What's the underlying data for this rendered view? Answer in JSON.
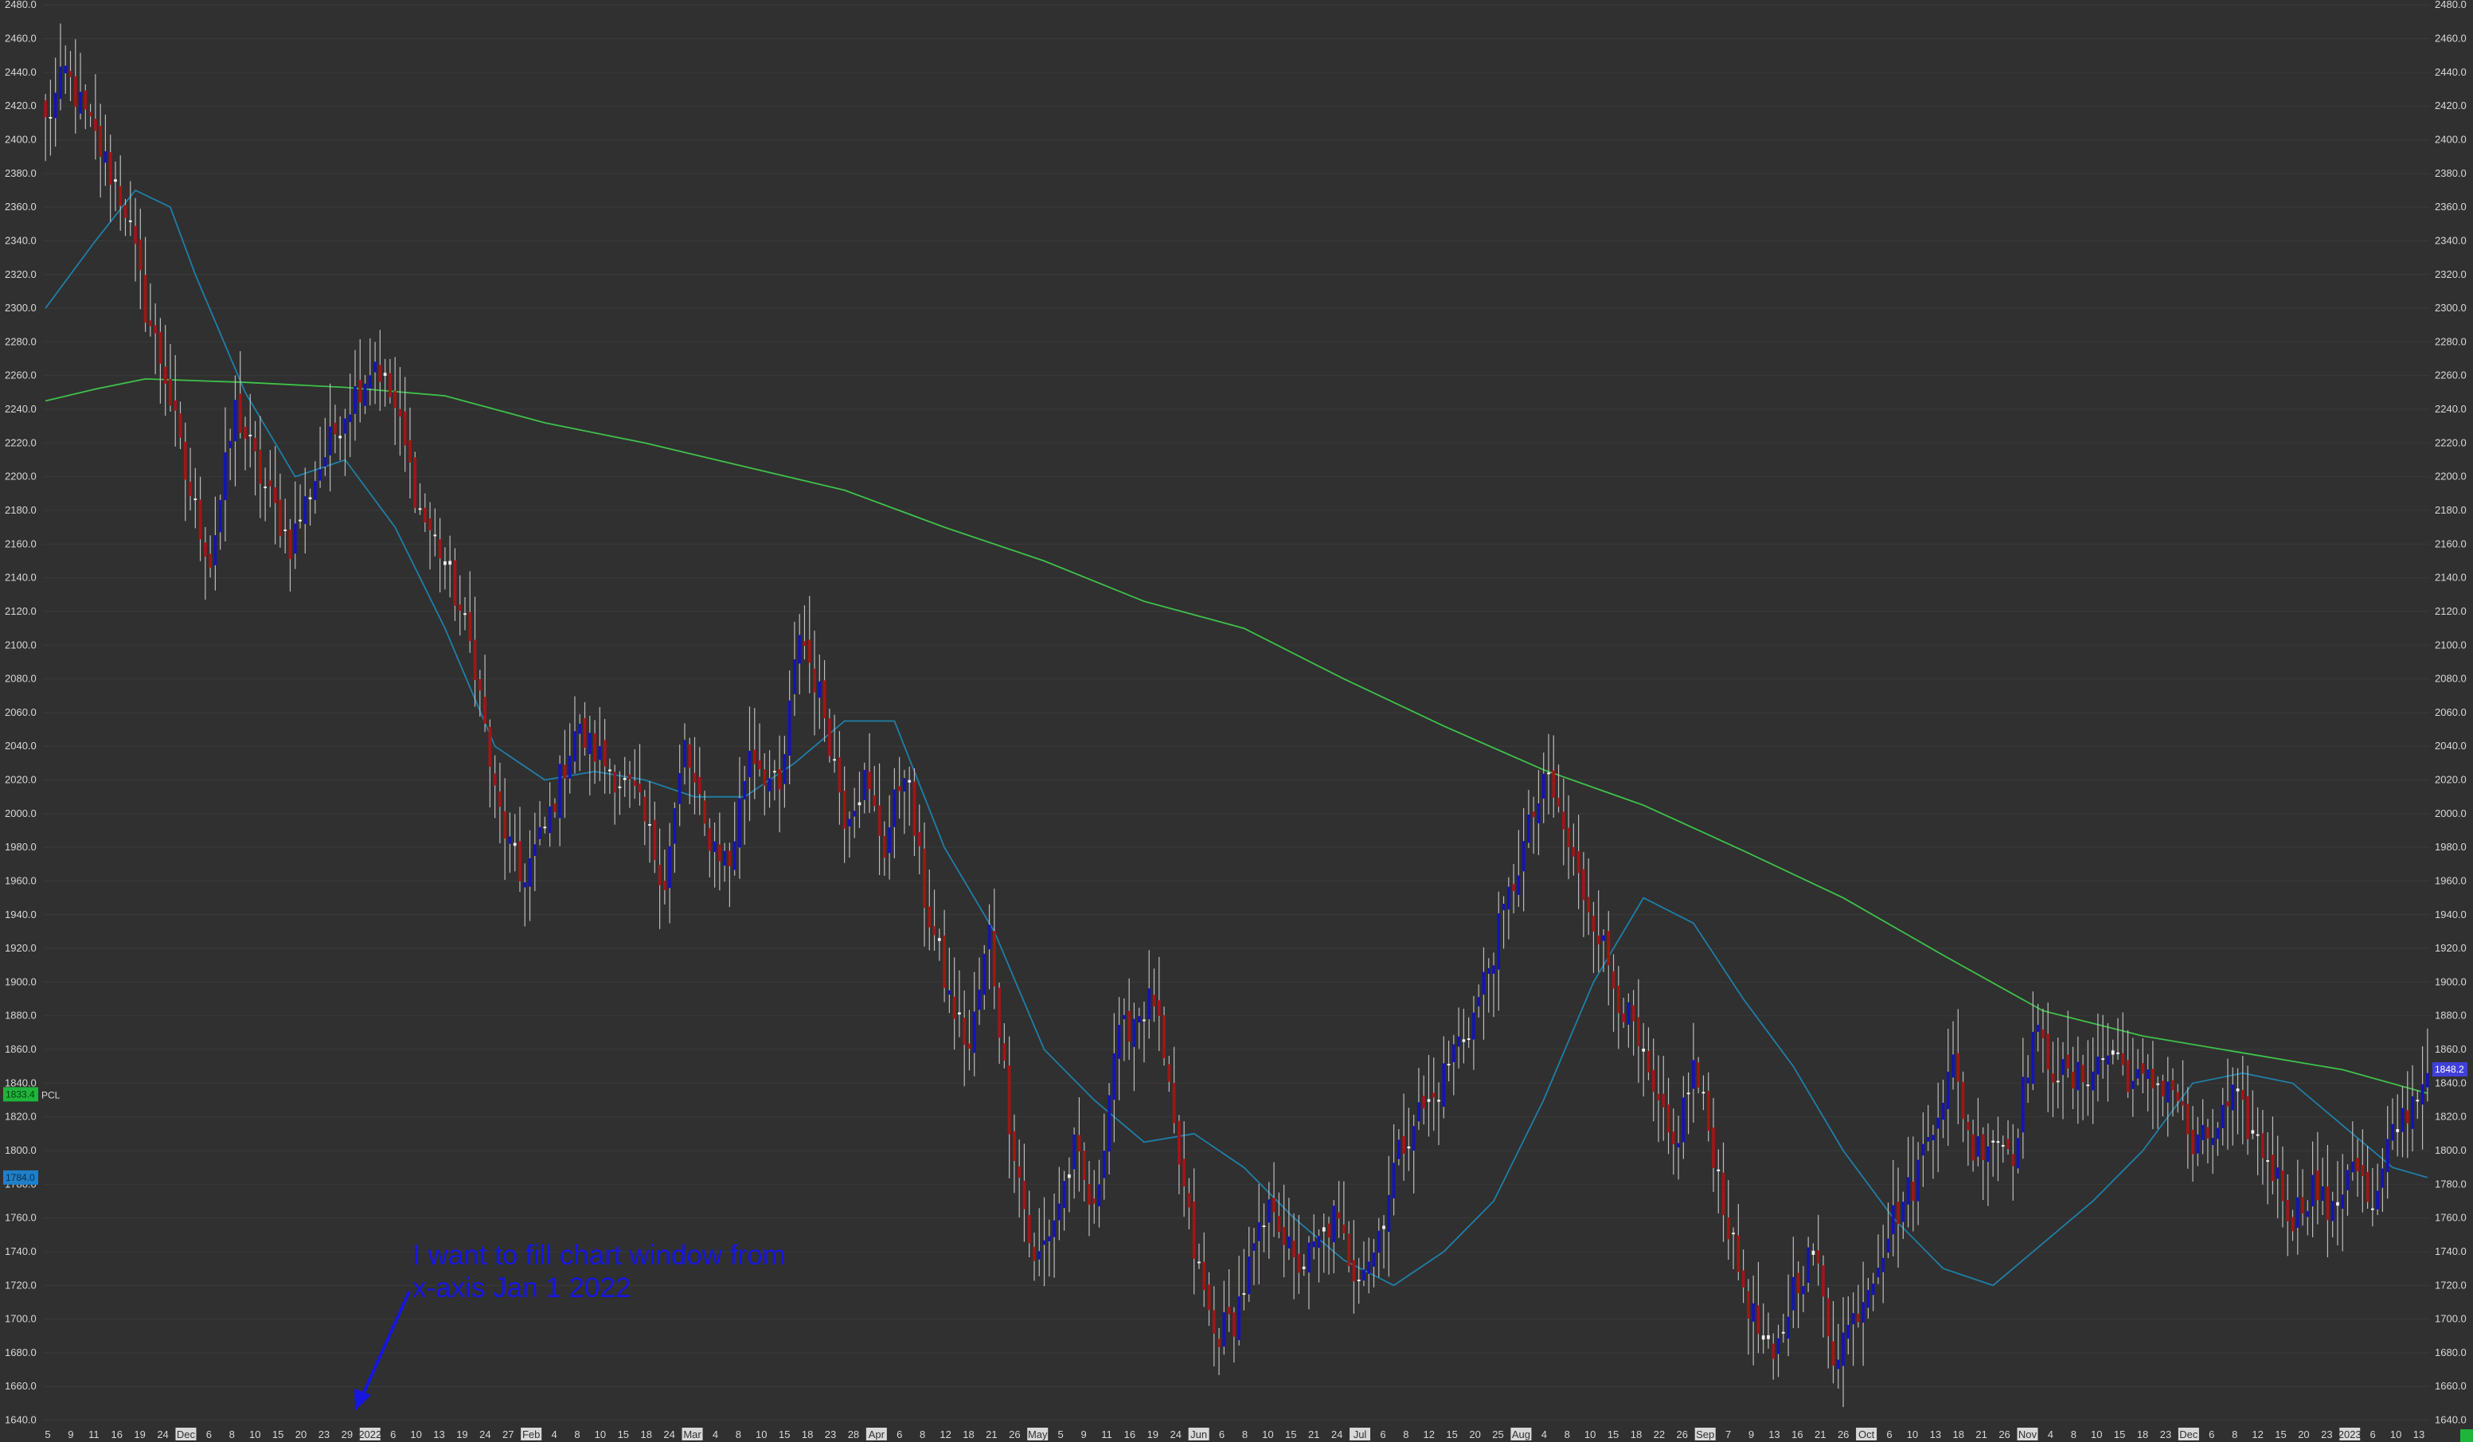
{
  "chart_data": {
    "type": "candlestick",
    "title": "",
    "xlabel": "",
    "ylabel": "",
    "ylim": [
      1636,
      2482
    ],
    "y_ticks": [
      1640,
      1660,
      1680,
      1700,
      1720,
      1740,
      1760,
      1780,
      1800,
      1820,
      1840,
      1860,
      1880,
      1900,
      1920,
      1940,
      1960,
      1980,
      2000,
      2020,
      2040,
      2060,
      2080,
      2100,
      2120,
      2140,
      2160,
      2180,
      2200,
      2220,
      2240,
      2260,
      2280,
      2300,
      2320,
      2340,
      2360,
      2380,
      2400,
      2420,
      2440,
      2460,
      2480
    ],
    "y_tick_decimals": 1,
    "x_tick_labels": [
      {
        "text": "5",
        "highlight": false
      },
      {
        "text": "9",
        "highlight": false
      },
      {
        "text": "11",
        "highlight": false
      },
      {
        "text": "16",
        "highlight": false
      },
      {
        "text": "19",
        "highlight": false
      },
      {
        "text": "24",
        "highlight": false
      },
      {
        "text": "Dec",
        "highlight": true
      },
      {
        "text": "6",
        "highlight": false
      },
      {
        "text": "8",
        "highlight": false
      },
      {
        "text": "10",
        "highlight": false
      },
      {
        "text": "15",
        "highlight": false
      },
      {
        "text": "20",
        "highlight": false
      },
      {
        "text": "23",
        "highlight": false
      },
      {
        "text": "29",
        "highlight": false
      },
      {
        "text": "2022",
        "highlight": true
      },
      {
        "text": "6",
        "highlight": false
      },
      {
        "text": "10",
        "highlight": false
      },
      {
        "text": "13",
        "highlight": false
      },
      {
        "text": "19",
        "highlight": false
      },
      {
        "text": "24",
        "highlight": false
      },
      {
        "text": "27",
        "highlight": false
      },
      {
        "text": "Feb",
        "highlight": true
      },
      {
        "text": "4",
        "highlight": false
      },
      {
        "text": "8",
        "highlight": false
      },
      {
        "text": "10",
        "highlight": false
      },
      {
        "text": "15",
        "highlight": false
      },
      {
        "text": "18",
        "highlight": false
      },
      {
        "text": "24",
        "highlight": false
      },
      {
        "text": "Mar",
        "highlight": true
      },
      {
        "text": "4",
        "highlight": false
      },
      {
        "text": "8",
        "highlight": false
      },
      {
        "text": "10",
        "highlight": false
      },
      {
        "text": "15",
        "highlight": false
      },
      {
        "text": "18",
        "highlight": false
      },
      {
        "text": "23",
        "highlight": false
      },
      {
        "text": "28",
        "highlight": false
      },
      {
        "text": "Apr",
        "highlight": true
      },
      {
        "text": "6",
        "highlight": false
      },
      {
        "text": "8",
        "highlight": false
      },
      {
        "text": "12",
        "highlight": false
      },
      {
        "text": "18",
        "highlight": false
      },
      {
        "text": "21",
        "highlight": false
      },
      {
        "text": "26",
        "highlight": false
      },
      {
        "text": "May",
        "highlight": true
      },
      {
        "text": "5",
        "highlight": false
      },
      {
        "text": "9",
        "highlight": false
      },
      {
        "text": "11",
        "highlight": false
      },
      {
        "text": "16",
        "highlight": false
      },
      {
        "text": "19",
        "highlight": false
      },
      {
        "text": "24",
        "highlight": false
      },
      {
        "text": "Jun",
        "highlight": true
      },
      {
        "text": "6",
        "highlight": false
      },
      {
        "text": "8",
        "highlight": false
      },
      {
        "text": "10",
        "highlight": false
      },
      {
        "text": "15",
        "highlight": false
      },
      {
        "text": "21",
        "highlight": false
      },
      {
        "text": "24",
        "highlight": false
      },
      {
        "text": "Jul",
        "highlight": true
      },
      {
        "text": "6",
        "highlight": false
      },
      {
        "text": "8",
        "highlight": false
      },
      {
        "text": "12",
        "highlight": false
      },
      {
        "text": "15",
        "highlight": false
      },
      {
        "text": "20",
        "highlight": false
      },
      {
        "text": "25",
        "highlight": false
      },
      {
        "text": "Aug",
        "highlight": true
      },
      {
        "text": "4",
        "highlight": false
      },
      {
        "text": "8",
        "highlight": false
      },
      {
        "text": "10",
        "highlight": false
      },
      {
        "text": "15",
        "highlight": false
      },
      {
        "text": "18",
        "highlight": false
      },
      {
        "text": "22",
        "highlight": false
      },
      {
        "text": "26",
        "highlight": false
      },
      {
        "text": "Sep",
        "highlight": true
      },
      {
        "text": "7",
        "highlight": false
      },
      {
        "text": "9",
        "highlight": false
      },
      {
        "text": "13",
        "highlight": false
      },
      {
        "text": "16",
        "highlight": false
      },
      {
        "text": "21",
        "highlight": false
      },
      {
        "text": "26",
        "highlight": false
      },
      {
        "text": "Oct",
        "highlight": true
      },
      {
        "text": "6",
        "highlight": false
      },
      {
        "text": "10",
        "highlight": false
      },
      {
        "text": "13",
        "highlight": false
      },
      {
        "text": "18",
        "highlight": false
      },
      {
        "text": "21",
        "highlight": false
      },
      {
        "text": "26",
        "highlight": false
      },
      {
        "text": "Nov",
        "highlight": true
      },
      {
        "text": "4",
        "highlight": false
      },
      {
        "text": "8",
        "highlight": false
      },
      {
        "text": "10",
        "highlight": false
      },
      {
        "text": "15",
        "highlight": false
      },
      {
        "text": "18",
        "highlight": false
      },
      {
        "text": "23",
        "highlight": false
      },
      {
        "text": "Dec",
        "highlight": true
      },
      {
        "text": "6",
        "highlight": false
      },
      {
        "text": "8",
        "highlight": false
      },
      {
        "text": "12",
        "highlight": false
      },
      {
        "text": "15",
        "highlight": false
      },
      {
        "text": "20",
        "highlight": false
      },
      {
        "text": "23",
        "highlight": false
      },
      {
        "text": "2023",
        "highlight": true
      },
      {
        "text": "6",
        "highlight": false
      },
      {
        "text": "10",
        "highlight": false
      },
      {
        "text": "13",
        "highlight": false
      }
    ],
    "anchors": [
      [
        0,
        2410
      ],
      [
        4,
        2440
      ],
      [
        10,
        2400
      ],
      [
        16,
        2360
      ],
      [
        20,
        2300
      ],
      [
        24,
        2260
      ],
      [
        28,
        2200
      ],
      [
        33,
        2150
      ],
      [
        38,
        2240
      ],
      [
        43,
        2200
      ],
      [
        49,
        2160
      ],
      [
        54,
        2200
      ],
      [
        60,
        2240
      ],
      [
        66,
        2270
      ],
      [
        70,
        2240
      ],
      [
        75,
        2180
      ],
      [
        80,
        2150
      ],
      [
        86,
        2090
      ],
      [
        90,
        2010
      ],
      [
        95,
        1960
      ],
      [
        100,
        1990
      ],
      [
        106,
        2050
      ],
      [
        112,
        2030
      ],
      [
        118,
        2010
      ],
      [
        124,
        1960
      ],
      [
        128,
        2040
      ],
      [
        132,
        1990
      ],
      [
        137,
        1970
      ],
      [
        141,
        2040
      ],
      [
        147,
        2010
      ],
      [
        151,
        2110
      ],
      [
        156,
        2060
      ],
      [
        160,
        2000
      ],
      [
        164,
        2020
      ],
      [
        168,
        1980
      ],
      [
        172,
        2030
      ],
      [
        176,
        1950
      ],
      [
        181,
        1890
      ],
      [
        185,
        1860
      ],
      [
        189,
        1930
      ],
      [
        193,
        1820
      ],
      [
        198,
        1730
      ],
      [
        202,
        1760
      ],
      [
        206,
        1800
      ],
      [
        210,
        1760
      ],
      [
        214,
        1860
      ],
      [
        218,
        1880
      ],
      [
        222,
        1890
      ],
      [
        226,
        1810
      ],
      [
        230,
        1740
      ],
      [
        234,
        1690
      ],
      [
        238,
        1700
      ],
      [
        242,
        1740
      ],
      [
        246,
        1770
      ],
      [
        250,
        1730
      ],
      [
        254,
        1740
      ],
      [
        258,
        1760
      ],
      [
        262,
        1730
      ],
      [
        266,
        1740
      ],
      [
        270,
        1790
      ],
      [
        274,
        1820
      ],
      [
        278,
        1830
      ],
      [
        282,
        1860
      ],
      [
        286,
        1880
      ],
      [
        290,
        1920
      ],
      [
        294,
        1960
      ],
      [
        298,
        2000
      ],
      [
        301,
        2020
      ],
      [
        304,
        1990
      ],
      [
        307,
        1960
      ],
      [
        310,
        1940
      ],
      [
        314,
        1900
      ],
      [
        318,
        1870
      ],
      [
        322,
        1830
      ],
      [
        326,
        1800
      ],
      [
        330,
        1850
      ],
      [
        334,
        1800
      ],
      [
        338,
        1740
      ],
      [
        342,
        1700
      ],
      [
        346,
        1670
      ],
      [
        350,
        1720
      ],
      [
        354,
        1740
      ],
      [
        358,
        1680
      ],
      [
        362,
        1700
      ],
      [
        366,
        1730
      ],
      [
        370,
        1760
      ],
      [
        374,
        1780
      ],
      [
        378,
        1820
      ],
      [
        382,
        1850
      ],
      [
        386,
        1800
      ],
      [
        390,
        1810
      ],
      [
        394,
        1800
      ],
      [
        398,
        1870
      ],
      [
        402,
        1850
      ],
      [
        406,
        1840
      ],
      [
        410,
        1850
      ],
      [
        414,
        1860
      ],
      [
        418,
        1840
      ],
      [
        422,
        1840
      ],
      [
        426,
        1840
      ],
      [
        430,
        1800
      ],
      [
        434,
        1810
      ],
      [
        438,
        1830
      ],
      [
        442,
        1810
      ],
      [
        446,
        1790
      ],
      [
        450,
        1760
      ],
      [
        454,
        1780
      ],
      [
        458,
        1760
      ],
      [
        462,
        1800
      ],
      [
        466,
        1760
      ],
      [
        470,
        1810
      ],
      [
        474,
        1830
      ],
      [
        477,
        1846
      ]
    ],
    "series": [
      {
        "kind": "moving-average",
        "color": "#1f7fa8",
        "points": [
          [
            0,
            2300
          ],
          [
            10,
            2340
          ],
          [
            18,
            2370
          ],
          [
            25,
            2360
          ],
          [
            30,
            2320
          ],
          [
            40,
            2250
          ],
          [
            50,
            2200
          ],
          [
            60,
            2210
          ],
          [
            70,
            2170
          ],
          [
            80,
            2110
          ],
          [
            90,
            2040
          ],
          [
            100,
            2020
          ],
          [
            110,
            2025
          ],
          [
            120,
            2020
          ],
          [
            130,
            2010
          ],
          [
            140,
            2010
          ],
          [
            150,
            2030
          ],
          [
            160,
            2055
          ],
          [
            170,
            2055
          ],
          [
            180,
            1980
          ],
          [
            190,
            1930
          ],
          [
            200,
            1860
          ],
          [
            210,
            1830
          ],
          [
            220,
            1805
          ],
          [
            230,
            1810
          ],
          [
            240,
            1790
          ],
          [
            250,
            1760
          ],
          [
            260,
            1735
          ],
          [
            270,
            1720
          ],
          [
            280,
            1740
          ],
          [
            290,
            1770
          ],
          [
            300,
            1830
          ],
          [
            310,
            1900
          ],
          [
            320,
            1950
          ],
          [
            330,
            1935
          ],
          [
            340,
            1890
          ],
          [
            350,
            1850
          ],
          [
            360,
            1800
          ],
          [
            370,
            1760
          ],
          [
            380,
            1730
          ],
          [
            390,
            1720
          ],
          [
            400,
            1745
          ],
          [
            410,
            1770
          ],
          [
            420,
            1800
          ],
          [
            430,
            1840
          ],
          [
            440,
            1846
          ],
          [
            450,
            1840
          ],
          [
            460,
            1815
          ],
          [
            470,
            1790
          ],
          [
            477,
            1784
          ]
        ]
      },
      {
        "kind": "moving-average",
        "color": "#3ec24a",
        "points": [
          [
            0,
            2245
          ],
          [
            10,
            2252
          ],
          [
            20,
            2258
          ],
          [
            40,
            2256
          ],
          [
            60,
            2253
          ],
          [
            80,
            2248
          ],
          [
            100,
            2232
          ],
          [
            120,
            2220
          ],
          [
            140,
            2206
          ],
          [
            160,
            2192
          ],
          [
            180,
            2170
          ],
          [
            200,
            2150
          ],
          [
            220,
            2126
          ],
          [
            240,
            2110
          ],
          [
            260,
            2080
          ],
          [
            280,
            2052
          ],
          [
            300,
            2026
          ],
          [
            320,
            2005
          ],
          [
            340,
            1978
          ],
          [
            360,
            1950
          ],
          [
            380,
            1916
          ],
          [
            400,
            1883
          ],
          [
            420,
            1868
          ],
          [
            440,
            1858
          ],
          [
            460,
            1848
          ],
          [
            477,
            1834
          ]
        ]
      }
    ],
    "price_badges": [
      {
        "label": "1848.2",
        "value": 1848.2,
        "side": "right",
        "bg": "#4040d8",
        "fg": "#ffffff"
      },
      {
        "label": "1833.4",
        "value": 1833.4,
        "side": "left",
        "bg": "#1fb43a",
        "fg": "#063e12"
      },
      {
        "label": "1784.0",
        "value": 1784.0,
        "side": "left",
        "bg": "#1f7fc8",
        "fg": "#0b2e4a"
      }
    ],
    "left_tag": "PCL",
    "colors": {
      "background": "#303030",
      "up": "#1414b4",
      "down": "#a01616",
      "wick": "#bcbcbc",
      "doji_body": "#f0f0f0",
      "axis_text": "#d8d8d8",
      "grid": "#3a3a3a",
      "annotation": "#1616e0"
    },
    "grid": true,
    "annotation": {
      "line1": "I want to fill chart window from",
      "line2": "x-axis Jan 1 2022",
      "arrow_date": "2022"
    }
  }
}
